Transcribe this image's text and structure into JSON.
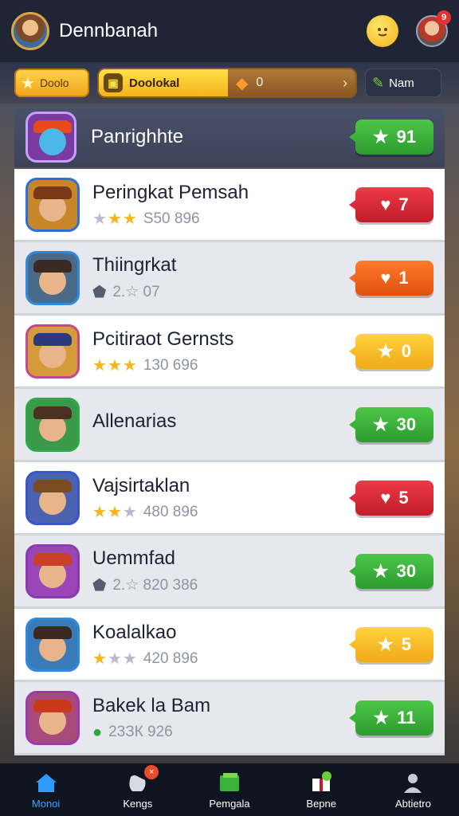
{
  "header": {
    "title": "Dennbanah",
    "emoji_icon": "smiley-icon",
    "notification_count": "9"
  },
  "filters": {
    "category_label": "Doolo",
    "main_label": "Doolokal",
    "coin_value": "0",
    "name_label": "Nam"
  },
  "leaderboard_header": {
    "name": "Panrighhte",
    "score": "91"
  },
  "rows": [
    {
      "title": "Peringkat Pemsah",
      "stars": [
        "grey",
        "gold",
        "gold"
      ],
      "meta": "S50 896",
      "badge": "7",
      "badge_color": "red",
      "bg": "light",
      "frame": "#2d6fd8",
      "hat": "#7a3a1a",
      "thumbbg": "#c8862a"
    },
    {
      "title": "Thiingrkat",
      "stars": [
        "dark"
      ],
      "meta": "2.☆ 07",
      "badge": "1",
      "badge_color": "orange",
      "bg": "dim",
      "frame": "#2d8ae0",
      "hat": "#3a2a22",
      "thumbbg": "#4a6a8a"
    },
    {
      "title": "Pcitiraot Gernsts",
      "stars": [
        "gold",
        "gold",
        "gold"
      ],
      "meta": "130 696",
      "badge": "0",
      "badge_color": "yellow",
      "bg": "light",
      "frame": "#c04a8a",
      "hat": "#2a3a7a",
      "thumbbg": "#d59a3a"
    },
    {
      "title": "Allenarias",
      "stars": [],
      "meta": "",
      "badge": "30",
      "badge_color": "green",
      "bg": "dim",
      "frame": "#2fa84a",
      "hat": "#4a3020",
      "thumbbg": "#3a9a4a"
    },
    {
      "title": "Vajsirtaklan",
      "stars": [
        "gold",
        "gold",
        "grey"
      ],
      "meta": "480 896",
      "badge": "5",
      "badge_color": "red",
      "bg": "light",
      "frame": "#3a56c8",
      "hat": "#7a4a20",
      "thumbbg": "#4a62b0"
    },
    {
      "title": "Uemmfad",
      "stars": [
        "dark"
      ],
      "meta": "2.☆ 820 386",
      "badge": "30",
      "badge_color": "green",
      "bg": "dim",
      "frame": "#8a3ab0",
      "hat": "#c8402a",
      "thumbbg": "#9a46b8"
    },
    {
      "title": "Koalalkao",
      "stars": [
        "gold",
        "grey",
        "grey"
      ],
      "meta": "420 896",
      "badge": "5",
      "badge_color": "yellow",
      "bg": "light",
      "frame": "#2d8ae0",
      "hat": "#3a2a20",
      "thumbbg": "#3a7ab8"
    },
    {
      "title": "Bakek la Bam",
      "stars": [
        "green"
      ],
      "meta": "23ЗК 926",
      "badge": "11",
      "badge_color": "green",
      "bg": "dim",
      "frame": "#9a3ab0",
      "hat": "#c83a1a",
      "thumbbg": "#a84a7a"
    }
  ],
  "nav": [
    {
      "label": "Monoi",
      "icon": "home-icon",
      "active": true
    },
    {
      "label": "Kengs",
      "icon": "hand-icon",
      "active": false,
      "badge": "×"
    },
    {
      "label": "Pemgala",
      "icon": "cards-icon",
      "active": false
    },
    {
      "label": "Bepne",
      "icon": "gift-icon",
      "active": false
    },
    {
      "label": "Abtietro",
      "icon": "person-icon",
      "active": false
    }
  ]
}
